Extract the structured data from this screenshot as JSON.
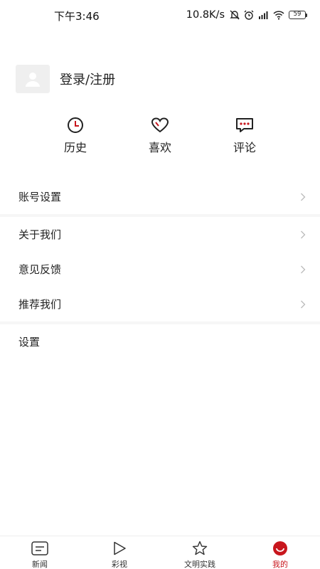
{
  "status_bar": {
    "time": "下午3:46",
    "net_speed": "10.8K/s",
    "battery": "59"
  },
  "profile": {
    "login_label": "登录/注册"
  },
  "quick_actions": [
    {
      "label": "历史",
      "icon": "clock-icon"
    },
    {
      "label": "喜欢",
      "icon": "heart-icon"
    },
    {
      "label": "评论",
      "icon": "comment-icon"
    }
  ],
  "menu": {
    "account_settings": "账号设置",
    "about_us": "关于我们",
    "feedback": "意见反馈",
    "recommend": "推荐我们",
    "settings": "设置"
  },
  "tabbar": {
    "items": [
      {
        "label": "新闻",
        "icon": "news-icon",
        "active": false
      },
      {
        "label": "彩视",
        "icon": "play-icon",
        "active": false
      },
      {
        "label": "文明实践",
        "icon": "star-icon",
        "active": false
      },
      {
        "label": "我的",
        "icon": "mine-icon",
        "active": true
      }
    ]
  },
  "colors": {
    "accent": "#c8161d",
    "text": "#222222",
    "divider": "#f6f6f6"
  }
}
